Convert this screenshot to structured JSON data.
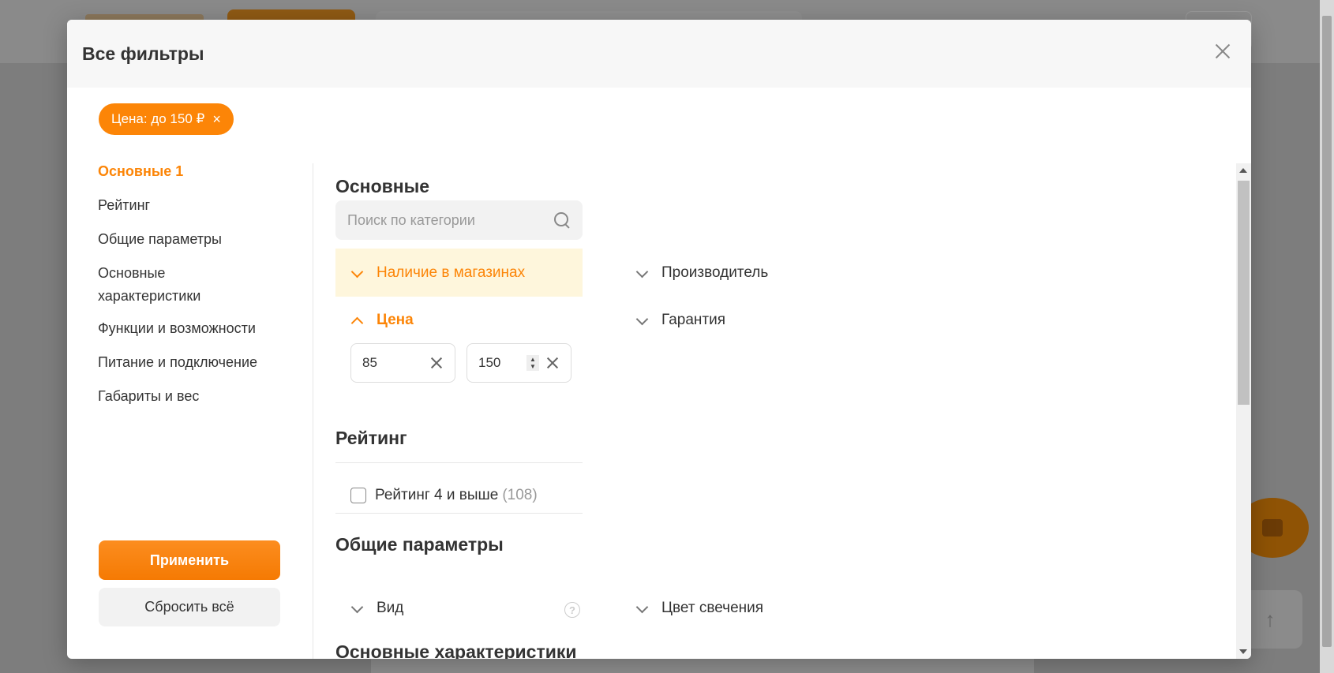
{
  "modal": {
    "title": "Все фильтры",
    "active_chip": "Цена: до 150 ₽",
    "chip_close_glyph": "×"
  },
  "nav": {
    "items": [
      {
        "label": "Основные 1",
        "active": true
      },
      {
        "label": "Рейтинг"
      },
      {
        "label": "Общие параметры"
      },
      {
        "label": "Основные характеристики"
      },
      {
        "label": "Функции и возможности"
      },
      {
        "label": "Питание и подключение"
      },
      {
        "label": "Габариты и вес"
      }
    ],
    "apply_label": "Применить",
    "reset_label": "Сбросить всё"
  },
  "sections": {
    "main": {
      "title": "Основные",
      "search_placeholder": "Поиск по категории",
      "filters": {
        "availability": "Наличие в магазинах",
        "manufacturer": "Производитель",
        "price": "Цена",
        "warranty": "Гарантия"
      },
      "price_from": "85",
      "price_to": "150"
    },
    "rating": {
      "title": "Рейтинг",
      "option_label": "Рейтинг 4 и выше",
      "option_count": "(108)"
    },
    "general": {
      "title": "Общие параметры",
      "filters": {
        "type": "Вид",
        "glow_color": "Цвет свечения"
      },
      "help_glyph": "?"
    },
    "characteristics": {
      "title": "Основные характеристики"
    }
  },
  "colors": {
    "accent": "#fc8507",
    "highlight_bg": "#fef6dc"
  }
}
